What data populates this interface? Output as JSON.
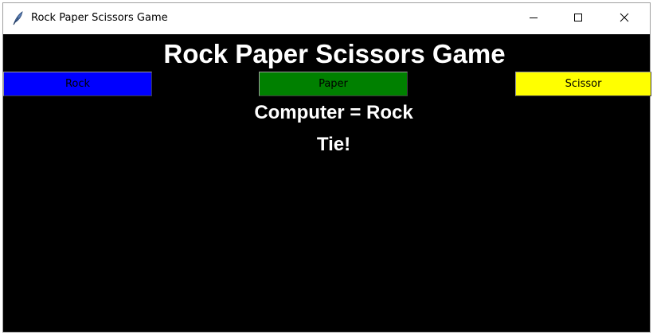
{
  "window": {
    "title": "Rock Paper Scissors Game",
    "icon": "feather-icon",
    "controls": [
      "minimize-icon",
      "maximize-icon",
      "close-icon"
    ]
  },
  "game": {
    "heading": "Rock Paper Scissors Game",
    "buttons": [
      {
        "label": "Rock",
        "color": "#0000ff"
      },
      {
        "label": "Paper",
        "color": "#008000"
      },
      {
        "label": "Scissor",
        "color": "#ffff00"
      }
    ],
    "computer_choice": "Computer = Rock",
    "result": "Tie!"
  },
  "colors": {
    "background": "#000000",
    "text": "#ffffff"
  }
}
